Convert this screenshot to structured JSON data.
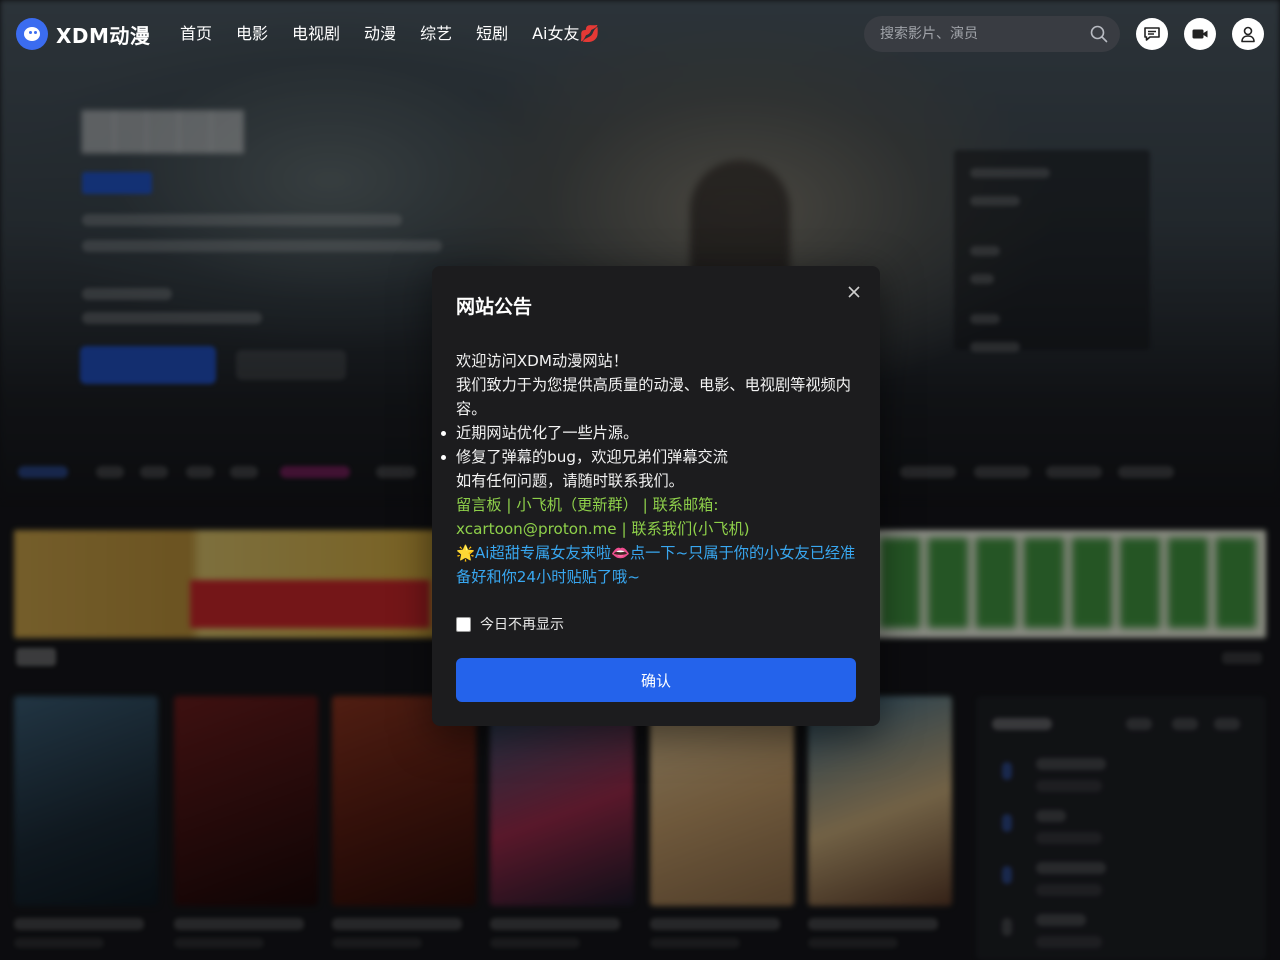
{
  "site": {
    "logo_text": "XDM动漫"
  },
  "nav": {
    "items": [
      {
        "label": "首页"
      },
      {
        "label": "电影"
      },
      {
        "label": "电视剧"
      },
      {
        "label": "动漫"
      },
      {
        "label": "综艺"
      },
      {
        "label": "短剧"
      },
      {
        "label": "Ai女友💋"
      }
    ]
  },
  "search": {
    "placeholder": "搜索影片、演员"
  },
  "header_icons": [
    "message-icon",
    "video-icon",
    "user-icon"
  ],
  "colors": {
    "accent": "#2463eb",
    "link_green": "#8ed04a",
    "link_blue": "#38a7f0",
    "modal_bg": "#1c1c1e"
  },
  "modal": {
    "title": "网站公告",
    "greeting": "欢迎访问XDM动漫网站！",
    "intro": "我们致力于为您提供高质量的动漫、电影、电视剧等视频内容。",
    "bullets": [
      "近期网站优化了一些片源。",
      "修复了弹幕的bug，欢迎兄弟们弹幕交流"
    ],
    "contact_note": "如有任何问题，请随时联系我们。",
    "links_line": "留言板 | 小飞机（更新群） | 联系邮箱: xcartoon@proton.me | 联系我们(小飞机)",
    "ai_line": "🌟Ai超甜专属女友来啦👄点一下~只属于你的小女友已经准备好和你24小时贴贴了哦~",
    "dont_show_label": "今日不再显示",
    "confirm_label": "确认"
  }
}
